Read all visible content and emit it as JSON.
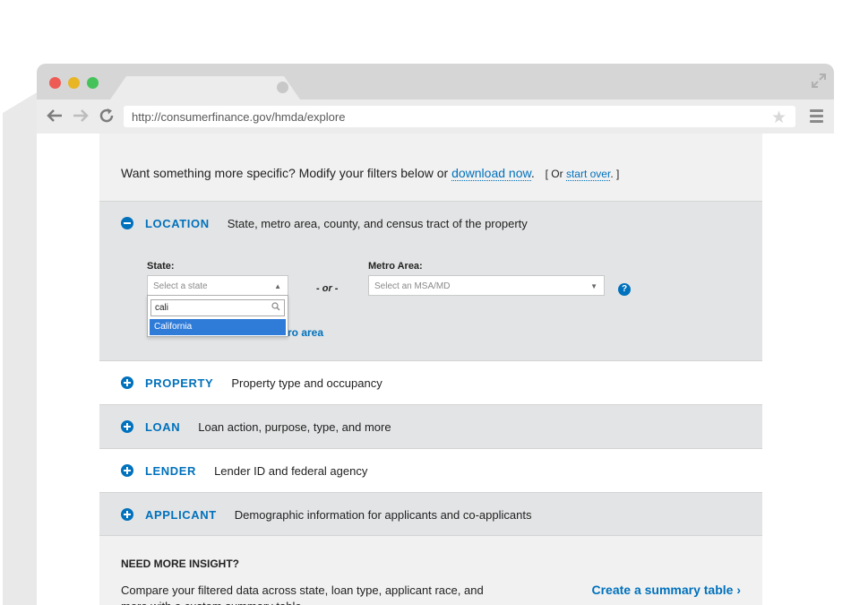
{
  "browser": {
    "url": "http://consumerfinance.gov/hmda/explore"
  },
  "intro": {
    "text": "Want something more specific? Modify your filters below or ",
    "download_link": "download now",
    "period": ".",
    "or_prefix": "[ Or ",
    "start_over_link": "start over",
    "or_suffix": ". ]"
  },
  "location": {
    "title": "LOCATION",
    "description": "State, metro area, county, and census tract of the property",
    "state_label": "State:",
    "state_placeholder": "Select a state",
    "or_text": "- or -",
    "metro_label": "Metro Area:",
    "metro_placeholder": "Select an MSA/MD",
    "help": "?",
    "search_value": "cali",
    "option": "California",
    "metro_link_partial": "tro area"
  },
  "sections": [
    {
      "title": "PROPERTY",
      "description": "Property type and occupancy"
    },
    {
      "title": "LOAN",
      "description": "Loan action, purpose, type, and more"
    },
    {
      "title": "LENDER",
      "description": "Lender ID and federal agency"
    },
    {
      "title": "APPLICANT",
      "description": "Demographic information for applicants and co-applicants"
    }
  ],
  "insight": {
    "title": "NEED MORE INSIGHT?",
    "text": "Compare your filtered data across state, loan type, applicant race, and more with a custom summary table.",
    "link": "Create a summary table ›"
  },
  "colors": {
    "accent": "#0071bc",
    "highlight": "#2f7bd8",
    "panel": "#e3e4e5"
  }
}
